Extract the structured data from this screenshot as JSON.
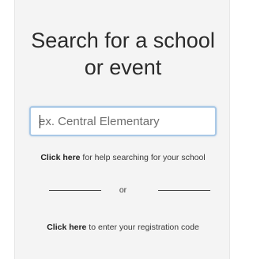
{
  "header": {
    "title_line1": "Search for a school",
    "title_line2": "or event"
  },
  "search": {
    "placeholder": "ex. Central Elementary"
  },
  "help": {
    "link_label": "Click here",
    "text": " for help searching for your school"
  },
  "divider": {
    "label": "or"
  },
  "registration": {
    "link_label": "Click here",
    "text": " to enter your registration code"
  },
  "colors": {
    "panel_background": "#f4f4f4",
    "input_border": "#a9c8e6",
    "text": "#2b2b2b"
  }
}
